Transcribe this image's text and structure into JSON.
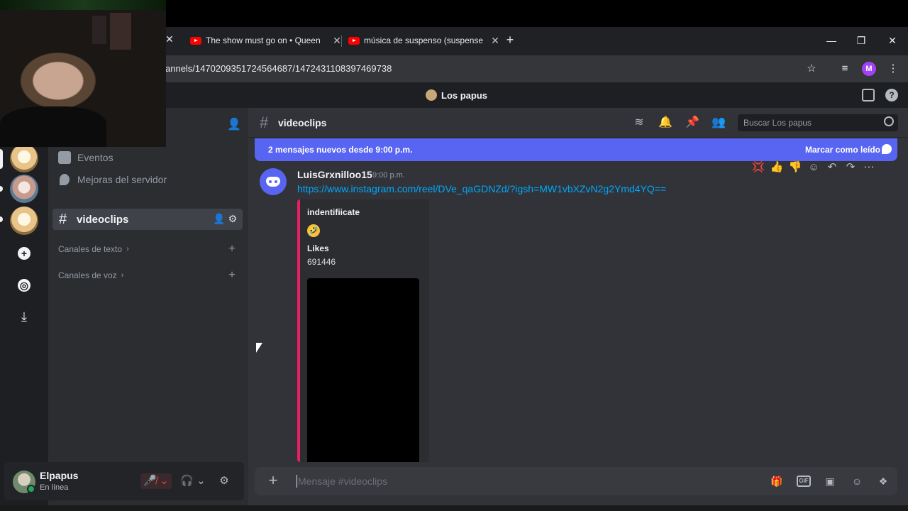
{
  "browser": {
    "tabs": [
      {
        "title": "The show must go on • Queen"
      },
      {
        "title": "música de suspenso (suspense"
      }
    ],
    "url": "annels/1470209351724564687/1472431108397469738",
    "profile_initial": "M"
  },
  "discord": {
    "server_name": "Los papus",
    "sidebar": {
      "items": [
        {
          "label": "Eventos"
        },
        {
          "label": "Mejoras del servidor"
        }
      ],
      "active_channel": "videoclips",
      "categories": [
        {
          "label": "Canales de texto"
        },
        {
          "label": "Canales de voz"
        }
      ]
    },
    "user": {
      "name": "Elpapus",
      "status": "En línea"
    },
    "channel_header": {
      "name": "videoclips",
      "search_placeholder": "Buscar Los papus"
    },
    "new_messages_bar": {
      "label": "2 mensajes nuevos desde 9:00 p.m.",
      "action": "Marcar como leído"
    },
    "message": {
      "author": "LuisGrxnilloo15",
      "time": "9:00 p.m.",
      "link": "https://www.instagram.com/reel/DVe_qaGDNZd/?igsh=MW1vbXZvN2g2Ymd4YQ==",
      "embed": {
        "title": "indentifiicate",
        "emoji": "🤣",
        "field_name": "Likes",
        "field_value": "691446"
      }
    },
    "composer": {
      "placeholder": "Mensaje #videoclips"
    },
    "accent": "#5865f2",
    "online_color": "#23a55a",
    "embed_color": "#e91e63"
  }
}
